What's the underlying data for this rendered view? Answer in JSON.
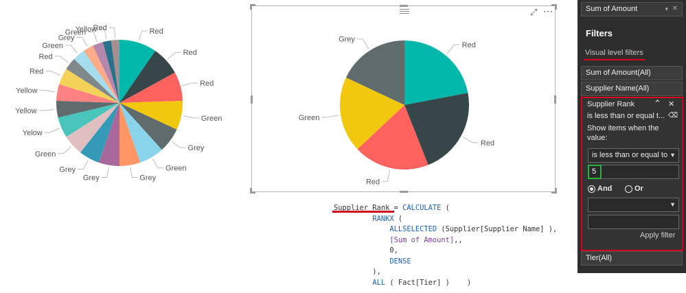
{
  "left_pie": {
    "slices": [
      {
        "label": "Red",
        "color": "#01B8AA"
      },
      {
        "label": "Red",
        "color": "#374649"
      },
      {
        "label": "Red",
        "color": "#FD625E"
      },
      {
        "label": "Green",
        "color": "#F2C80F"
      },
      {
        "label": "Grey",
        "color": "#5F6B6D"
      },
      {
        "label": "Green",
        "color": "#8AD4EB"
      },
      {
        "label": "Grey",
        "color": "#FE9666"
      },
      {
        "label": "Grey",
        "color": "#A66999"
      },
      {
        "label": "Grey",
        "color": "#3599B8"
      },
      {
        "label": "Green",
        "color": "#DFBFBF"
      },
      {
        "label": "Yelow",
        "color": "#4AC5BB"
      },
      {
        "label": "Yellow",
        "color": "#5F6B6D"
      },
      {
        "label": "Yellow",
        "color": "#FB8281"
      },
      {
        "label": "Red",
        "color": "#F4D25A"
      },
      {
        "label": "Red",
        "color": "#7F898A"
      },
      {
        "label": "Green",
        "color": "#A4DDEE"
      },
      {
        "label": "Grey",
        "color": "#FDAB89"
      },
      {
        "label": "Green",
        "color": "#B687AC"
      },
      {
        "label": "Yellow",
        "color": "#28738A"
      },
      {
        "label": "Red",
        "color": "#A78F8F"
      }
    ]
  },
  "center_pie": {
    "slices": [
      {
        "label": "Red",
        "value": 22,
        "color": "#01B8AA"
      },
      {
        "label": "Red",
        "value": 22,
        "color": "#374649"
      },
      {
        "label": "Red",
        "value": 19,
        "color": "#FD625E"
      },
      {
        "label": "Green",
        "value": 19,
        "color": "#F2C80F"
      },
      {
        "label": "Grey",
        "value": 18,
        "color": "#5F6B6D"
      }
    ]
  },
  "dax": {
    "line1_measure": "Supplier Rank",
    "line1_eq": " = ",
    "line1_fn": "CALCULATE",
    "line1_paren": " (",
    "line2": "RANKX",
    "line2_paren": " (",
    "line3_fn": "ALLSELECTED",
    "line3_arg": " (Supplier[Supplier Name] ),",
    "line4_measure": "[Sum of Amount]",
    "line4_rest": ",,",
    "line5": "0,",
    "line6": "DENSE",
    "line7": "),",
    "line8_fn": "ALL",
    "line8_arg": " ( Fact[Tier] )    )"
  },
  "pane": {
    "top_field": "Sum of Amount",
    "title": "Filters",
    "section": "Visual level filters",
    "filter1": "Sum of Amount(All)",
    "filter2": "Supplier Name(All)",
    "card": {
      "title": "Supplier Rank",
      "summary": "is less than or equal t...",
      "show_items": "Show items when the",
      "value_label": "value:",
      "condition": "is less than or equal to",
      "value": "5",
      "and_label": "And",
      "or_label": "Or",
      "apply": "Apply filter"
    },
    "filter3": "Tier(All)"
  }
}
